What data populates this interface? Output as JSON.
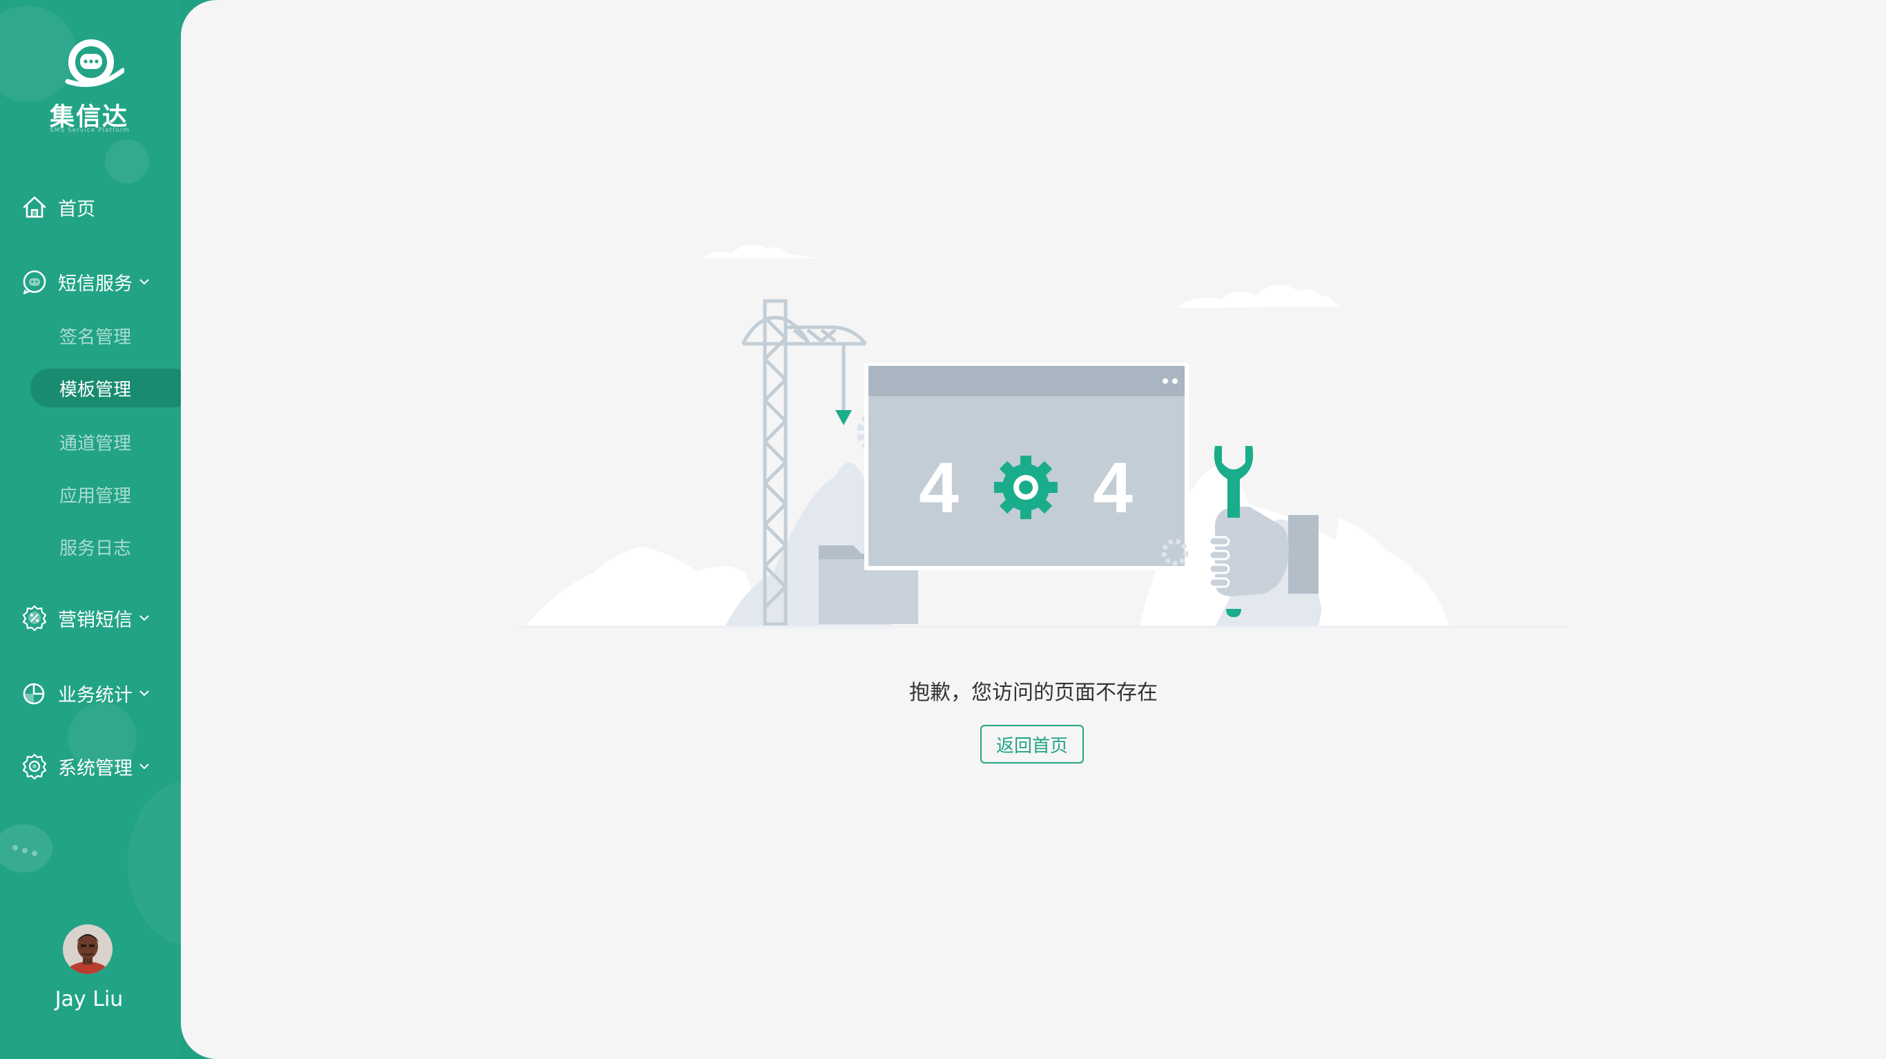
{
  "brand": {
    "name": "集信达",
    "subtitle": "SMS Service Platform"
  },
  "sidebar": {
    "nav": {
      "home": "首页",
      "sms_service": "短信服务",
      "marketing_sms": "营销短信",
      "business_stats": "业务统计",
      "system_management": "系统管理"
    },
    "sms_sub": [
      {
        "label": "签名管理"
      },
      {
        "label": "模板管理",
        "active": true
      },
      {
        "label": "通道管理"
      },
      {
        "label": "应用管理"
      },
      {
        "label": "服务日志"
      }
    ]
  },
  "user": {
    "name": "Jay Liu"
  },
  "error": {
    "code_left": "4",
    "code_right": "4",
    "message": "抱歉，您访问的页面不存在",
    "home_button": "返回首页"
  },
  "colors": {
    "brand": "#22a386",
    "brand_dark": "#188b70",
    "illustration_gray": "#c3cdd6",
    "accent": "#1aad8c"
  },
  "icons": {
    "home": "home-icon",
    "sms": "chat-bubble-icon",
    "marketing": "percent-gear-icon",
    "stats": "pie-chart-icon",
    "system": "gear-icon",
    "chevron": "chevron-down-icon"
  }
}
